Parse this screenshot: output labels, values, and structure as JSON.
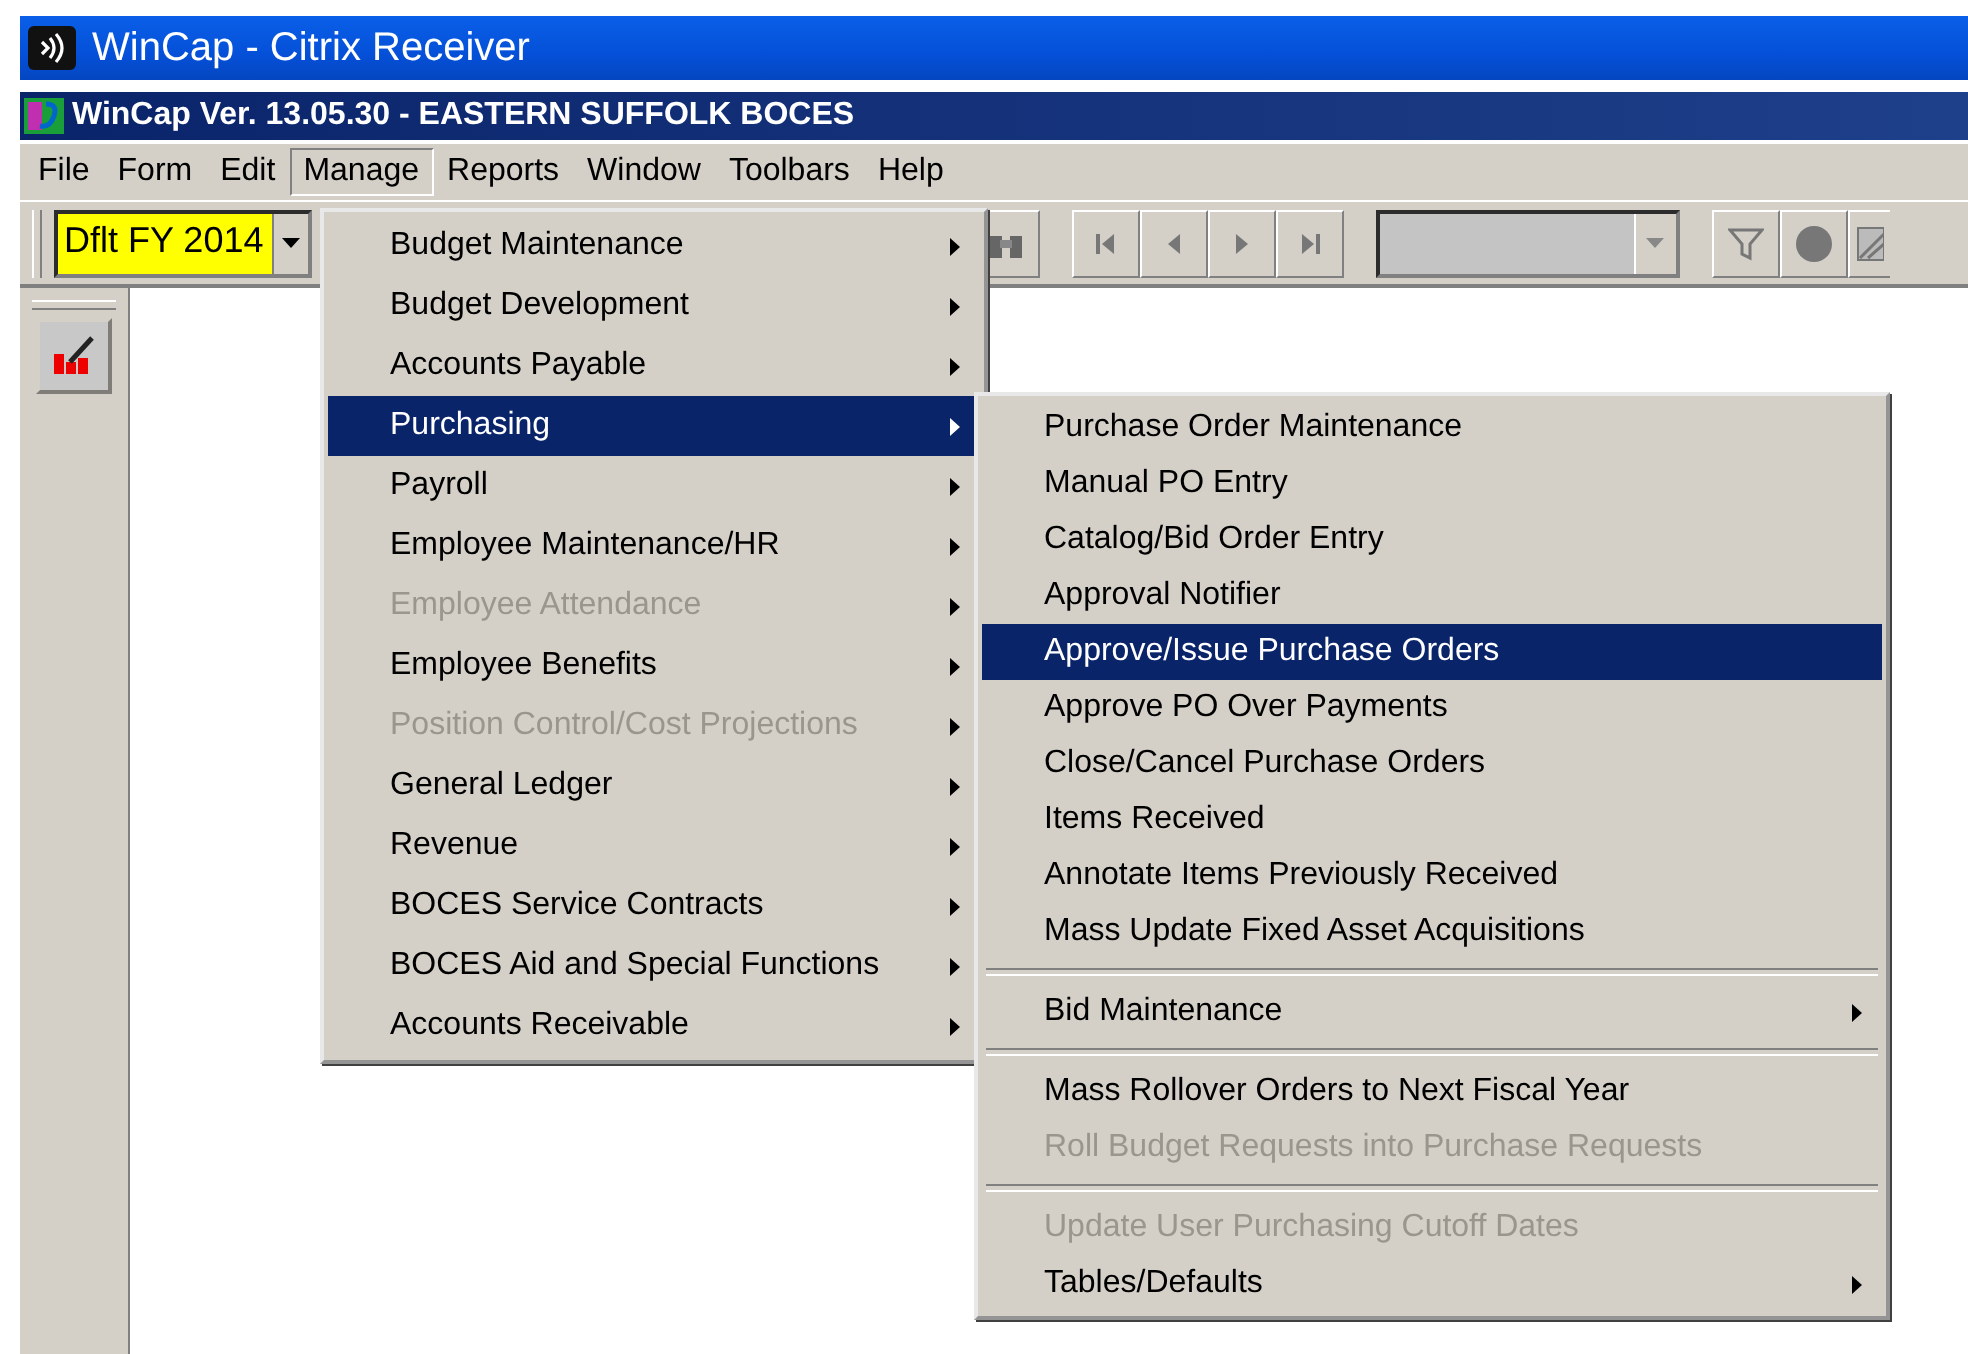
{
  "window": {
    "title": "WinCap - Citrix Receiver"
  },
  "app_title": "WinCap Ver. 13.05.30 - EASTERN SUFFOLK BOCES",
  "menu_bar": [
    {
      "label": "File",
      "selected": false
    },
    {
      "label": "Form",
      "selected": false
    },
    {
      "label": "Edit",
      "selected": false
    },
    {
      "label": "Manage",
      "selected": true
    },
    {
      "label": "Reports",
      "selected": false
    },
    {
      "label": "Window",
      "selected": false
    },
    {
      "label": "Toolbars",
      "selected": false
    },
    {
      "label": "Help",
      "selected": false
    }
  ],
  "toolbar": {
    "fiscal_year": "Dflt FY 2014"
  },
  "manage_menu": [
    {
      "label": "Budget Maintenance",
      "disabled": false,
      "selected": false
    },
    {
      "label": "Budget Development",
      "disabled": false,
      "selected": false
    },
    {
      "label": "Accounts Payable",
      "disabled": false,
      "selected": false
    },
    {
      "label": "Purchasing",
      "disabled": false,
      "selected": true
    },
    {
      "label": "Payroll",
      "disabled": false,
      "selected": false
    },
    {
      "label": "Employee Maintenance/HR",
      "disabled": false,
      "selected": false
    },
    {
      "label": "Employee Attendance",
      "disabled": true,
      "selected": false
    },
    {
      "label": "Employee Benefits",
      "disabled": false,
      "selected": false
    },
    {
      "label": "Position Control/Cost Projections",
      "disabled": true,
      "selected": false
    },
    {
      "label": "General Ledger",
      "disabled": false,
      "selected": false
    },
    {
      "label": "Revenue",
      "disabled": false,
      "selected": false
    },
    {
      "label": "BOCES Service Contracts",
      "disabled": false,
      "selected": false
    },
    {
      "label": "BOCES Aid and Special Functions",
      "disabled": false,
      "selected": false
    },
    {
      "label": "Accounts Receivable",
      "disabled": false,
      "selected": false
    }
  ],
  "purchasing_menu": [
    {
      "kind": "item",
      "label": "Purchase Order Maintenance",
      "disabled": false,
      "selected": false,
      "submenu": false
    },
    {
      "kind": "item",
      "label": "Manual PO Entry",
      "disabled": false,
      "selected": false,
      "submenu": false
    },
    {
      "kind": "item",
      "label": "Catalog/Bid Order Entry",
      "disabled": false,
      "selected": false,
      "submenu": false
    },
    {
      "kind": "item",
      "label": "Approval Notifier",
      "disabled": false,
      "selected": false,
      "submenu": false
    },
    {
      "kind": "item",
      "label": "Approve/Issue Purchase Orders",
      "disabled": false,
      "selected": true,
      "submenu": false
    },
    {
      "kind": "item",
      "label": "Approve PO Over Payments",
      "disabled": false,
      "selected": false,
      "submenu": false
    },
    {
      "kind": "item",
      "label": "Close/Cancel Purchase Orders",
      "disabled": false,
      "selected": false,
      "submenu": false
    },
    {
      "kind": "item",
      "label": "Items Received",
      "disabled": false,
      "selected": false,
      "submenu": false
    },
    {
      "kind": "item",
      "label": "Annotate Items Previously Received",
      "disabled": false,
      "selected": false,
      "submenu": false
    },
    {
      "kind": "item",
      "label": "Mass Update Fixed Asset Acquisitions",
      "disabled": false,
      "selected": false,
      "submenu": false
    },
    {
      "kind": "separator"
    },
    {
      "kind": "item",
      "label": "Bid Maintenance",
      "disabled": false,
      "selected": false,
      "submenu": true
    },
    {
      "kind": "separator"
    },
    {
      "kind": "item",
      "label": "Mass Rollover Orders to Next Fiscal Year",
      "disabled": false,
      "selected": false,
      "submenu": false
    },
    {
      "kind": "item",
      "label": "Roll Budget Requests into Purchase Requests",
      "disabled": true,
      "selected": false,
      "submenu": false
    },
    {
      "kind": "separator"
    },
    {
      "kind": "item",
      "label": "Update User Purchasing Cutoff Dates",
      "disabled": true,
      "selected": false,
      "submenu": false
    },
    {
      "kind": "item",
      "label": "Tables/Defaults",
      "disabled": false,
      "selected": false,
      "submenu": true
    }
  ]
}
